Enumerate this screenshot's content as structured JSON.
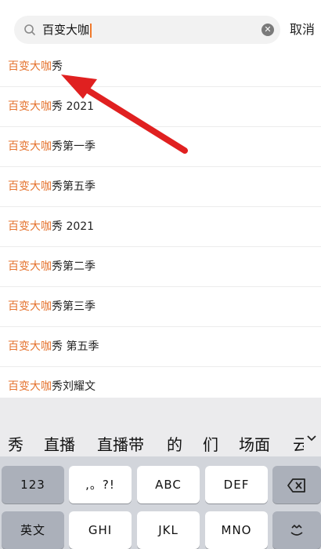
{
  "search": {
    "query": "百变大咖",
    "cancel_label": "取消"
  },
  "suggestions": [
    {
      "highlight": "百变大咖",
      "rest": "秀"
    },
    {
      "highlight": "百变大咖",
      "rest": "秀 2021"
    },
    {
      "highlight": "百变大咖",
      "rest": "秀第一季"
    },
    {
      "highlight": "百变大咖",
      "rest": "秀第五季"
    },
    {
      "highlight": "百变大咖",
      "rest": "秀 2021"
    },
    {
      "highlight": "百变大咖",
      "rest": "秀第二季"
    },
    {
      "highlight": "百变大咖",
      "rest": "秀第三季"
    },
    {
      "highlight": "百变大咖",
      "rest": "秀 第五季"
    },
    {
      "highlight": "百变大咖",
      "rest": "秀刘耀文"
    }
  ],
  "colors": {
    "highlight": "#e5732f",
    "annotation_arrow": "#e02020"
  },
  "keyboard": {
    "candidates": [
      "秀",
      "直播",
      "直播带",
      "的",
      "们",
      "场面",
      "云"
    ],
    "keys": {
      "numbers": "123",
      "punct": ",。?!",
      "abc": "ABC",
      "def": "DEF",
      "delete_icon": "backspace-icon",
      "lang": "英文",
      "ghi": "GHI",
      "jkl": "JKL",
      "mno": "MNO",
      "emoji_icon": "emoji-icon"
    }
  }
}
